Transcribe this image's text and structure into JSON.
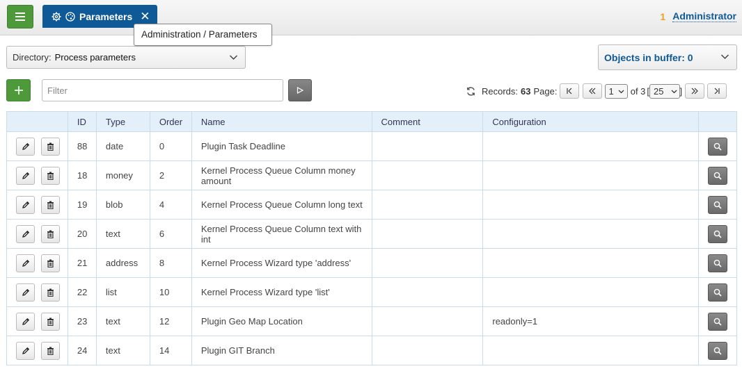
{
  "header": {
    "tab_label": "Parameters",
    "tooltip": "Administration / Parameters",
    "user_count": "1",
    "user_name": "Administrator"
  },
  "toolbar": {
    "directory_label": "Directory:",
    "directory_value": "Process parameters",
    "buffer_label": "Objects in buffer:",
    "buffer_count": "0",
    "filter_placeholder": "Filter"
  },
  "pager": {
    "records_label": "Records:",
    "records_count": "63",
    "page_label": "Page:",
    "page_value": "1",
    "of_label": "of 3",
    "page_size": "25"
  },
  "table": {
    "columns": [
      "",
      "ID",
      "Type",
      "Order",
      "Name",
      "Comment",
      "Configuration",
      ""
    ],
    "rows": [
      {
        "id": "88",
        "type": "date",
        "order": "0",
        "name": "Plugin Task Deadline",
        "comment": "",
        "config": ""
      },
      {
        "id": "18",
        "type": "money",
        "order": "2",
        "name": "Kernel Process Queue Column money amount",
        "comment": "",
        "config": ""
      },
      {
        "id": "19",
        "type": "blob",
        "order": "4",
        "name": "Kernel Process Queue Column long text",
        "comment": "",
        "config": ""
      },
      {
        "id": "20",
        "type": "text",
        "order": "6",
        "name": "Kernel Process Queue Column text with int",
        "comment": "",
        "config": ""
      },
      {
        "id": "21",
        "type": "address",
        "order": "8",
        "name": "Kernel Process Wizard type 'address'",
        "comment": "",
        "config": ""
      },
      {
        "id": "22",
        "type": "list",
        "order": "10",
        "name": "Kernel Process Wizard type 'list'",
        "comment": "",
        "config": ""
      },
      {
        "id": "23",
        "type": "text",
        "order": "12",
        "name": "Plugin Geo Map Location",
        "comment": "",
        "config": "readonly=1"
      },
      {
        "id": "24",
        "type": "text",
        "order": "14",
        "name": "Plugin GIT Branch",
        "comment": "",
        "config": ""
      }
    ]
  },
  "icons": {
    "menu": "hamburger-icon",
    "settings": "gear-icon",
    "palette": "palette-icon",
    "close": "close-icon",
    "add": "plus-icon",
    "run": "play-icon",
    "refresh": "refresh-icon",
    "edit": "pencil-icon",
    "delete": "trash-icon",
    "find": "search-icon"
  },
  "colors": {
    "primary": "#0f5a96",
    "success": "#4e9a3a",
    "badge": "#f0a020",
    "table_header": "#e3eff9"
  }
}
